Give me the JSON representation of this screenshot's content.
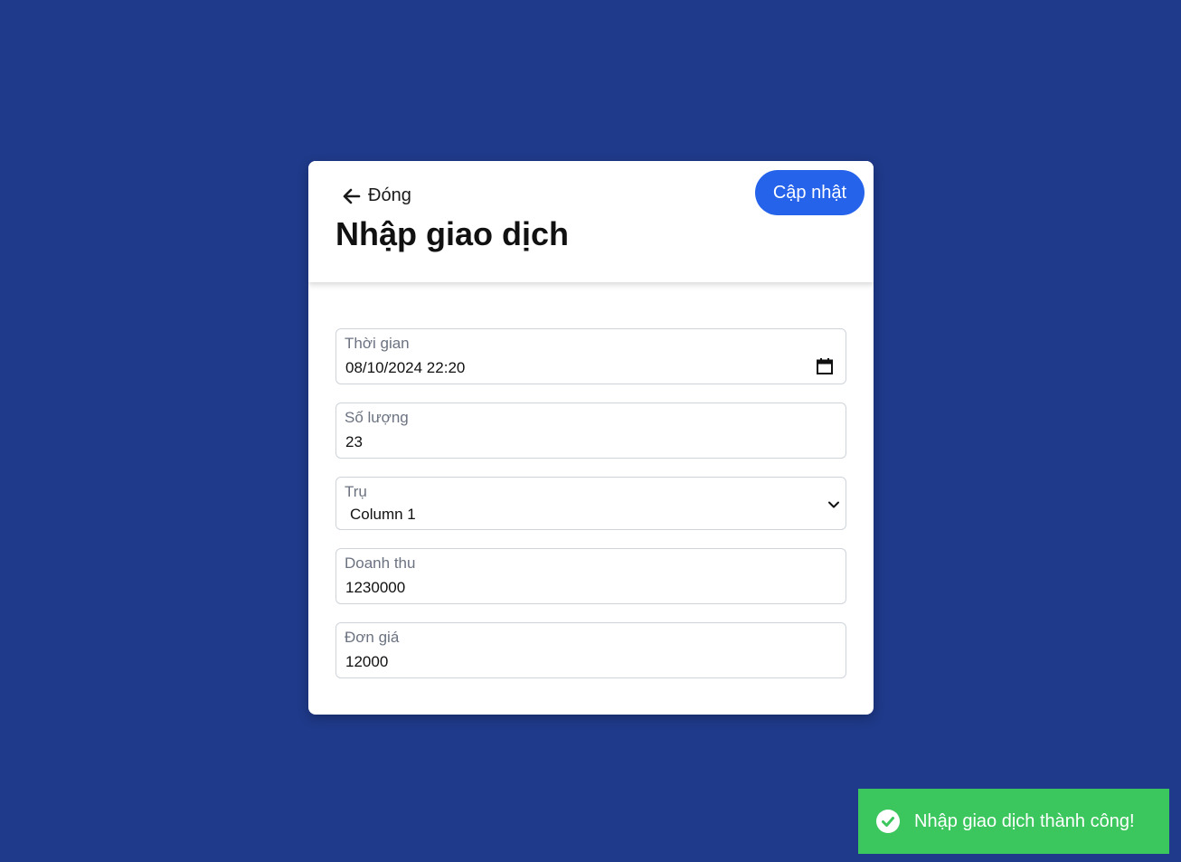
{
  "header": {
    "back_label": "Đóng",
    "title": "Nhập giao dịch",
    "update_label": "Cập nhật"
  },
  "form": {
    "time": {
      "label": "Thời gian",
      "value": "08/10/2024 22:20"
    },
    "quantity": {
      "label": "Số lượng",
      "value": "23"
    },
    "pump": {
      "label": "Trụ",
      "selected": "Column 1"
    },
    "revenue": {
      "label": "Doanh thu",
      "value": "1230000"
    },
    "unit_price": {
      "label": "Đơn giá",
      "value": "12000"
    }
  },
  "toast": {
    "message": "Nhập giao dịch thành công!",
    "icon": "check-circle-icon"
  },
  "colors": {
    "background": "#1f3a8a",
    "accent": "#2563eb",
    "success": "#3cc65e"
  }
}
